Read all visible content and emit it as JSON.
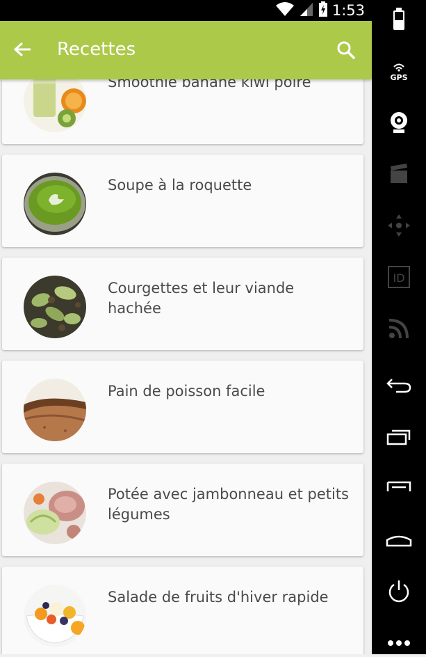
{
  "status_bar": {
    "time": "1:53"
  },
  "app_bar": {
    "title": "Recettes"
  },
  "recipes": [
    {
      "name": "Smoothie banane kiwi poire",
      "image": "smoothie-photo"
    },
    {
      "name": "Soupe à la roquette",
      "image": "soup-photo"
    },
    {
      "name": "Courgettes et leur viande hachée",
      "image": "zucchini-photo"
    },
    {
      "name": "Pain de poisson facile",
      "image": "fish-bread-photo"
    },
    {
      "name": "Potée avec jambonneau et petits légumes",
      "image": "stew-photo"
    },
    {
      "name": "Salade de fruits d'hiver rapide",
      "image": "fruit-salad-photo"
    }
  ],
  "emulator_panel": {
    "buttons": [
      "battery-icon",
      "gps-icon",
      "camera-icon",
      "video-icon",
      "dpad-icon",
      "id-icon",
      "rss-icon",
      "back-icon",
      "recent-apps-icon",
      "menu-icon",
      "home-icon",
      "power-icon",
      "more-icon"
    ],
    "gps_label": "GPS",
    "id_label": "ID"
  },
  "colors": {
    "accent": "#adc94a",
    "text": "#4a4a4a"
  }
}
